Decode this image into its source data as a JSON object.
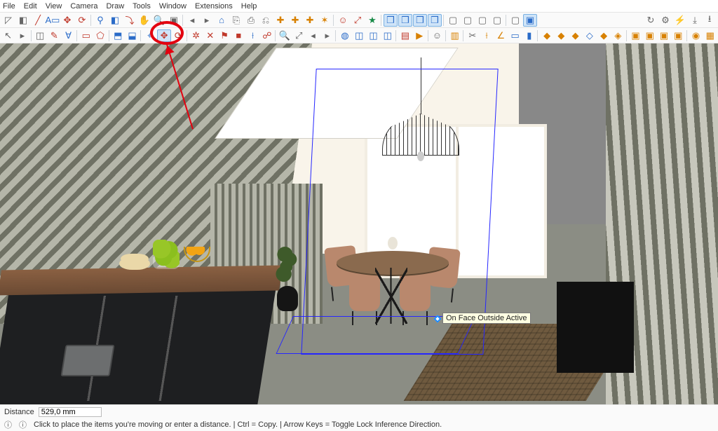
{
  "menu": [
    "File",
    "Edit",
    "View",
    "Camera",
    "Draw",
    "Tools",
    "Window",
    "Extensions",
    "Help"
  ],
  "toolbar_row1": [
    {
      "n": "select-icon",
      "c": "gray",
      "g": "◸"
    },
    {
      "n": "erase-icon",
      "c": "gray",
      "g": "◧"
    },
    {
      "n": "line-icon",
      "c": "red",
      "g": "╱"
    },
    {
      "n": "text-icon",
      "c": "blue",
      "g": "A▭"
    },
    {
      "n": "move-icon",
      "c": "red",
      "g": "✥"
    },
    {
      "n": "rotate-icon",
      "c": "red",
      "g": "⟳"
    },
    {
      "sep": true
    },
    {
      "n": "find-icon",
      "c": "blue",
      "g": "⚲"
    },
    {
      "n": "color-icon",
      "c": "blue",
      "g": "◧"
    },
    {
      "n": "orbit-icon",
      "c": "red",
      "g": "⤵"
    },
    {
      "n": "pan-icon",
      "c": "gray",
      "g": "✋"
    },
    {
      "n": "zoom-icon",
      "c": "gray",
      "g": "🔍"
    },
    {
      "n": "zoomwin-icon",
      "c": "gray",
      "g": "▣"
    },
    {
      "sep": true
    },
    {
      "n": "prev-icon",
      "c": "gray",
      "g": "◂"
    },
    {
      "n": "next-icon",
      "c": "gray",
      "g": "▸"
    },
    {
      "n": "home-icon",
      "c": "blue",
      "g": "⌂"
    },
    {
      "n": "clipboard-icon",
      "c": "gray",
      "g": "⎘"
    },
    {
      "n": "paste-icon",
      "c": "gray",
      "g": "⎙"
    },
    {
      "n": "copy-icon",
      "c": "gray",
      "g": "⎌"
    },
    {
      "n": "node1-icon",
      "c": "orange",
      "g": "✚"
    },
    {
      "n": "node2-icon",
      "c": "orange",
      "g": "✚"
    },
    {
      "n": "node3-icon",
      "c": "orange",
      "g": "✚"
    },
    {
      "n": "node4-icon",
      "c": "orange",
      "g": "✶"
    },
    {
      "sep": true
    },
    {
      "n": "person-icon",
      "c": "red",
      "g": "☺"
    },
    {
      "n": "scale-icon",
      "c": "red",
      "g": "⤢"
    },
    {
      "n": "mirror-icon",
      "c": "green",
      "g": "★"
    },
    {
      "sep": true
    },
    {
      "n": "cube-solid-icon",
      "c": "blue",
      "g": "❒",
      "sel": true
    },
    {
      "n": "cube-out-icon",
      "c": "blue",
      "g": "❒",
      "sel": true
    },
    {
      "n": "cube-wire-icon",
      "c": "blue",
      "g": "❒",
      "sel": true
    },
    {
      "n": "cube-rot-icon",
      "c": "blue",
      "g": "❒",
      "sel": true
    },
    {
      "sep": true
    },
    {
      "n": "box1-icon",
      "c": "gray",
      "g": "▢"
    },
    {
      "n": "box2-icon",
      "c": "gray",
      "g": "▢"
    },
    {
      "n": "box3-icon",
      "c": "gray",
      "g": "▢"
    },
    {
      "n": "box4-icon",
      "c": "gray",
      "g": "▢"
    },
    {
      "sep": true
    },
    {
      "n": "box5-icon",
      "c": "gray",
      "g": "▢"
    },
    {
      "n": "box6-icon",
      "c": "blue",
      "g": "▣",
      "sel": true
    },
    {
      "spacer": true
    },
    {
      "n": "sync-icon",
      "c": "gray",
      "g": "↻"
    },
    {
      "n": "gear-icon",
      "c": "gray",
      "g": "⚙"
    },
    {
      "n": "plug-icon",
      "c": "gray",
      "g": "⚡"
    },
    {
      "n": "export-icon",
      "c": "gray",
      "g": "⤓"
    },
    {
      "n": "share-icon",
      "c": "gray",
      "g": "⭳"
    }
  ],
  "toolbar_row2": [
    {
      "n": "cursor-icon",
      "c": "gray",
      "g": "↖"
    },
    {
      "n": "pick-icon",
      "c": "gray",
      "g": "▸"
    },
    {
      "sep": true
    },
    {
      "n": "eraser-icon",
      "c": "gray",
      "g": "◫"
    },
    {
      "n": "pencil-icon",
      "c": "red",
      "g": "✎"
    },
    {
      "n": "arc-icon",
      "c": "blue",
      "g": "Ɐ"
    },
    {
      "sep": true
    },
    {
      "n": "rect-icon",
      "c": "red",
      "g": "▭"
    },
    {
      "n": "poly-icon",
      "c": "red",
      "g": "⬠"
    },
    {
      "sep": true
    },
    {
      "n": "push-icon",
      "c": "blue",
      "g": "⬒"
    },
    {
      "n": "follow-icon",
      "c": "blue",
      "g": "⬓"
    },
    {
      "sep": true
    },
    {
      "n": "anchor-icon",
      "c": "blue",
      "g": "⌖"
    },
    {
      "n": "move2-icon",
      "c": "red",
      "g": "✥",
      "sel": true
    },
    {
      "n": "rotate2-icon",
      "c": "red",
      "g": "⟳"
    },
    {
      "sep": true
    },
    {
      "n": "axis-icon",
      "c": "red",
      "g": "✲"
    },
    {
      "n": "split-icon",
      "c": "red",
      "g": "✕"
    },
    {
      "n": "flag-icon",
      "c": "red",
      "g": "⚑"
    },
    {
      "n": "section-icon",
      "c": "red",
      "g": "■"
    },
    {
      "n": "tape-icon",
      "c": "blue",
      "g": "⟊"
    },
    {
      "n": "walk-icon",
      "c": "red",
      "g": "☍"
    },
    {
      "sep": true
    },
    {
      "n": "zoom2-icon",
      "c": "gray",
      "g": "🔍"
    },
    {
      "n": "zoomext-icon",
      "c": "gray",
      "g": "⤢"
    },
    {
      "n": "prev2-icon",
      "c": "gray",
      "g": "◂"
    },
    {
      "n": "next2-icon",
      "c": "gray",
      "g": "▸"
    },
    {
      "sep": true
    },
    {
      "n": "globe-icon",
      "c": "blue",
      "g": "◍"
    },
    {
      "n": "layer1-icon",
      "c": "blue",
      "g": "◫"
    },
    {
      "n": "layer2-icon",
      "c": "blue",
      "g": "◫"
    },
    {
      "n": "layer3-icon",
      "c": "blue",
      "g": "◫"
    },
    {
      "sep": true
    },
    {
      "n": "scene-icon",
      "c": "red",
      "g": "▤"
    },
    {
      "n": "animate-icon",
      "c": "orange",
      "g": "▶"
    },
    {
      "sep": true
    },
    {
      "n": "user-icon",
      "c": "gray",
      "g": "☺"
    },
    {
      "sep": true
    },
    {
      "n": "tray-icon",
      "c": "orange",
      "g": "▥"
    },
    {
      "sep": true
    },
    {
      "n": "knife-icon",
      "c": "gray",
      "g": "✂"
    },
    {
      "n": "ruler-icon",
      "c": "orange",
      "g": "⟊"
    },
    {
      "n": "angle-icon",
      "c": "orange",
      "g": "∠"
    },
    {
      "n": "measure-icon",
      "c": "blue",
      "g": "▭"
    },
    {
      "n": "wall-icon",
      "c": "blue",
      "g": "▮"
    },
    {
      "sep": true
    },
    {
      "n": "mat1-icon",
      "c": "orange",
      "g": "◆"
    },
    {
      "n": "mat2-icon",
      "c": "orange",
      "g": "◆"
    },
    {
      "n": "mat3-icon",
      "c": "orange",
      "g": "◆"
    },
    {
      "n": "mat4-icon",
      "c": "blue",
      "g": "◇"
    },
    {
      "n": "mat5-icon",
      "c": "orange",
      "g": "◆"
    },
    {
      "n": "mat6-icon",
      "c": "orange",
      "g": "◈"
    },
    {
      "sep": true
    },
    {
      "n": "comp1-icon",
      "c": "orange",
      "g": "▣"
    },
    {
      "n": "comp2-icon",
      "c": "orange",
      "g": "▣"
    },
    {
      "n": "comp3-icon",
      "c": "orange",
      "g": "▣"
    },
    {
      "n": "comp4-icon",
      "c": "orange",
      "g": "▣"
    },
    {
      "sep": true
    },
    {
      "n": "render-icon",
      "c": "orange",
      "g": "◉"
    },
    {
      "n": "paint-icon",
      "c": "orange",
      "g": "▦"
    }
  ],
  "tooltip": "On Face Outside Active",
  "status": {
    "distance_label": "Distance",
    "distance_value": "529,0 mm",
    "hint": "Click to place the items you're moving or enter a distance.  |  Ctrl = Copy.  |  Arrow Keys = Toggle Lock Inference Direction."
  }
}
